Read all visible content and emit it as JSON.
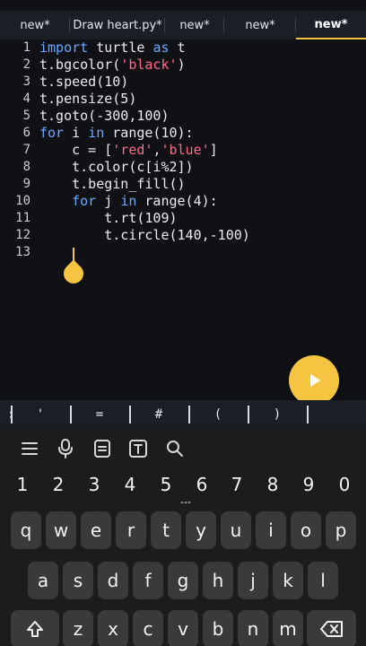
{
  "tabs": [
    {
      "label": "new*",
      "active": false
    },
    {
      "label": "Draw heart.py*",
      "active": false
    },
    {
      "label": "new*",
      "active": false
    },
    {
      "label": "new*",
      "active": false
    },
    {
      "label": "new*",
      "active": true
    }
  ],
  "editor": {
    "line_numbers": [
      "1",
      "2",
      "3",
      "4",
      "5",
      "6",
      "7",
      "8",
      "9",
      "10",
      "11",
      "12",
      "13"
    ],
    "lines": {
      "l1_kw1": "import",
      "l1_rest1": " turtle ",
      "l1_kw2": "as",
      "l1_rest2": " t",
      "l2_a": "t.bgcolor(",
      "l2_str": "'black'",
      "l2_b": ")",
      "l3": "t.speed(10)",
      "l4": "t.pensize(5)",
      "l5": "t.goto(-300,100)",
      "l6_kw1": "for",
      "l6_a": " i ",
      "l6_kw2": "in",
      "l6_b": " range(10):",
      "l7_a": "    c = [",
      "l7_s1": "'red'",
      "l7_c": ",",
      "l7_s2": "'blue'",
      "l7_b": "]",
      "l8": "    t.color(c[i%2])",
      "l9": "    t.begin_fill()",
      "l10_ind": "    ",
      "l10_kw1": "for",
      "l10_a": " j ",
      "l10_kw2": "in",
      "l10_b": " range(4):",
      "l11": "        t.rt(109)",
      "l12": "        t.circle(140,-100)"
    }
  },
  "symbols": [
    ":",
    "'",
    "=",
    "#",
    "(",
    ")",
    ""
  ],
  "keyboard": {
    "numbers": [
      "1",
      "2",
      "3",
      "4",
      "5",
      "6",
      "7",
      "8",
      "9",
      "0"
    ],
    "row1": [
      "q",
      "w",
      "e",
      "r",
      "t",
      "y",
      "u",
      "i",
      "o",
      "p"
    ],
    "row2": [
      "a",
      "s",
      "d",
      "f",
      "g",
      "h",
      "j",
      "k",
      "l"
    ],
    "row3": [
      "z",
      "x",
      "c",
      "v",
      "b",
      "n",
      "m"
    ]
  },
  "colors": {
    "accent": "#f5c542",
    "background": "#0f1114",
    "keyword": "#6aa9ff",
    "string": "#ff6b8a",
    "key": "#3a3a3c"
  },
  "icons": {
    "run": "play-icon",
    "toolbar": [
      "menu-icon",
      "microphone-icon",
      "clipboard-icon",
      "text-icon",
      "search-icon"
    ],
    "shift": "shift-icon",
    "backspace": "backspace-icon"
  }
}
